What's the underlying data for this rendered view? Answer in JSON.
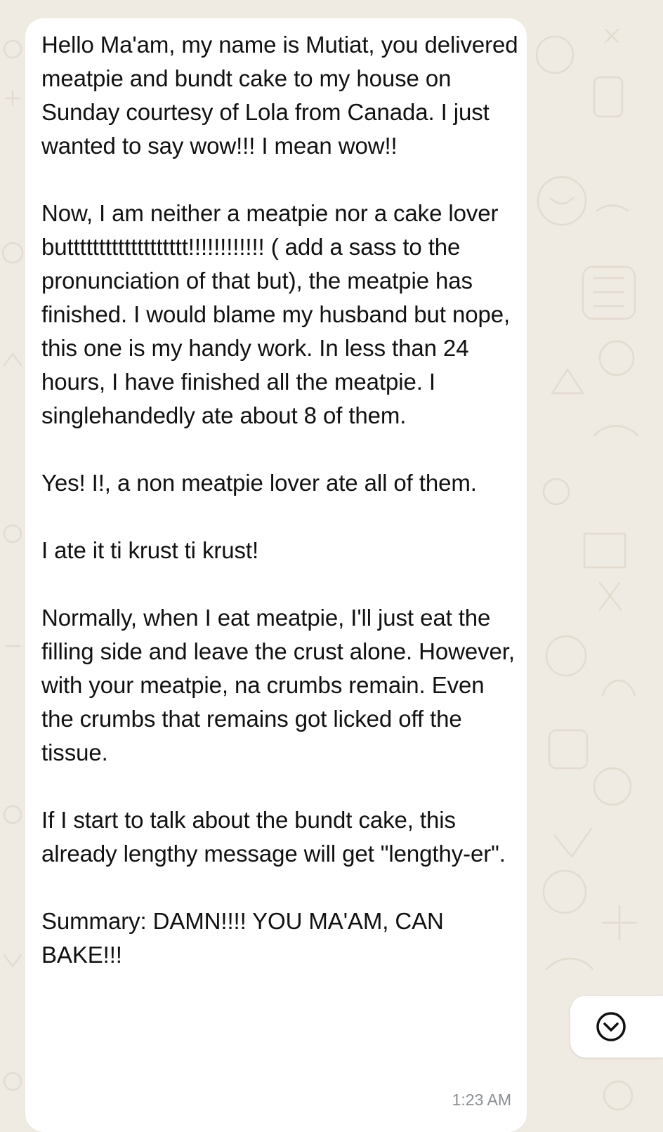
{
  "chat": {
    "message": {
      "paragraphs": [
        "Hello Ma'am,  my name is Mutiat,  you delivered meatpie and bundt cake to my house on Sunday courtesy of Lola from Canada. I just wanted to say wow!!! I mean wow!!",
        "Now, I am neither a meatpie nor a cake lover buttttttttttttttttttt!!!!!!!!!!!! ( add a sass to the pronunciation of that but), the meatpie has finished.  I would blame my husband but nope, this one is my handy work. In less than 24 hours, I have finished all the meatpie. I singlehandedly ate about 8 of them.",
        "Yes! I!, a non meatpie lover ate all of them.",
        "I ate it ti krust ti krust!",
        "Normally,  when I eat meatpie, I'll just eat the filling side and leave the crust alone. However, with your meatpie,  na crumbs remain. Even the crumbs that remains got licked off the tissue.",
        "If I start to talk about the bundt cake, this already lengthy message will get \"lengthy-er\".",
        "Summary: DAMN!!!! YOU MA'AM, CAN BAKE!!!"
      ],
      "time": "1:23 AM"
    },
    "scroll_button": {
      "icon": "chevron-down-icon"
    }
  },
  "colors": {
    "chat_background": "#efeae2",
    "bubble_background": "#ffffff",
    "message_text": "#111111",
    "timestamp": "#8a8f93",
    "doodle": "#e3dbcf"
  }
}
